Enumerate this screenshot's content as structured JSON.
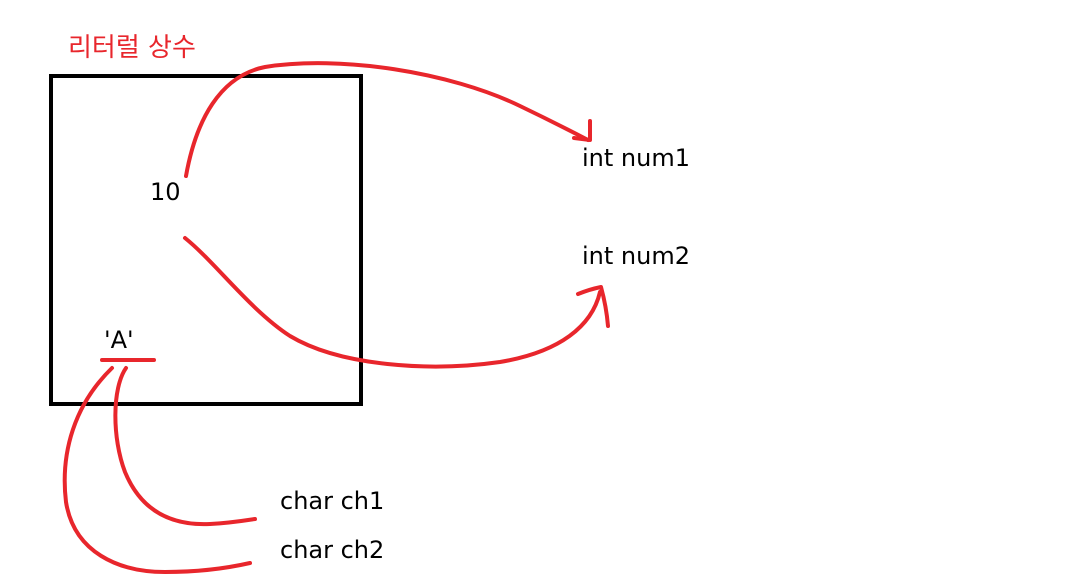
{
  "title": "리터럴 상수",
  "literals": {
    "number": "10",
    "char": "'A'"
  },
  "variables": {
    "num1": "int num1",
    "num2": "int num2",
    "ch1": "char ch1",
    "ch2": "char ch2"
  },
  "colors": {
    "annotation": "#e8262c",
    "box": "#000000",
    "text": "#000000"
  }
}
